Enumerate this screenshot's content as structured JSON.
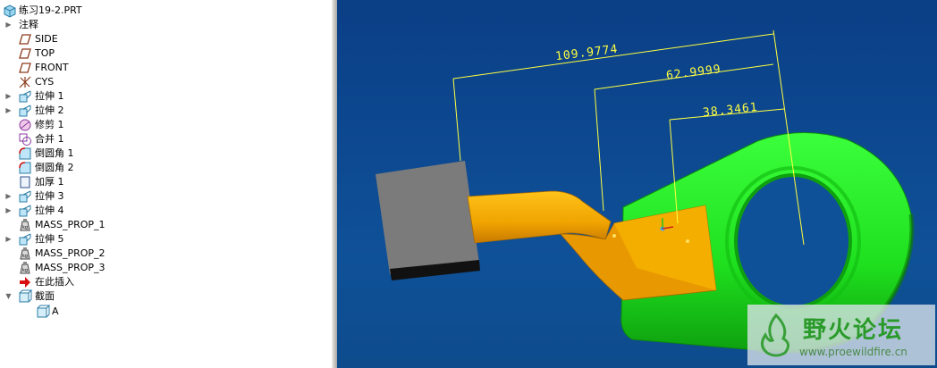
{
  "model_tree": {
    "root": "练习19-2.PRT",
    "items": [
      {
        "label": "注释",
        "icon": "annotation-folder-icon",
        "expandable": true
      },
      {
        "label": "SIDE",
        "icon": "datum-plane-icon",
        "expandable": false
      },
      {
        "label": "TOP",
        "icon": "datum-plane-icon",
        "expandable": false
      },
      {
        "label": "FRONT",
        "icon": "datum-plane-icon",
        "expandable": false
      },
      {
        "label": "CYS",
        "icon": "coordinate-system-icon",
        "expandable": false
      },
      {
        "label": "拉伸 1",
        "icon": "extrude-icon",
        "expandable": true
      },
      {
        "label": "拉伸 2",
        "icon": "extrude-icon",
        "expandable": true
      },
      {
        "label": "修剪 1",
        "icon": "trim-icon",
        "expandable": false
      },
      {
        "label": "合并 1",
        "icon": "merge-icon",
        "expandable": false
      },
      {
        "label": "倒圆角 1",
        "icon": "round-icon",
        "expandable": false
      },
      {
        "label": "倒圆角 2",
        "icon": "round-icon",
        "expandable": false
      },
      {
        "label": "加厚 1",
        "icon": "thicken-icon",
        "expandable": false
      },
      {
        "label": "拉伸 3",
        "icon": "extrude-icon",
        "expandable": true
      },
      {
        "label": "拉伸 4",
        "icon": "extrude-icon",
        "expandable": true
      },
      {
        "label": "MASS_PROP_1",
        "icon": "analysis-icon",
        "expandable": false
      },
      {
        "label": "拉伸 5",
        "icon": "extrude-icon",
        "expandable": true
      },
      {
        "label": "MASS_PROP_2",
        "icon": "analysis-icon",
        "expandable": false
      },
      {
        "label": "MASS_PROP_3",
        "icon": "analysis-icon",
        "expandable": false
      },
      {
        "label": "在此插入",
        "icon": "insert-here-arrow-icon",
        "expandable": false
      },
      {
        "label": "截面",
        "icon": "section-icon",
        "expandable": true,
        "expanded": true
      },
      {
        "label": "A",
        "icon": "section-icon",
        "expandable": false
      }
    ]
  },
  "viewport": {
    "dimensions": [
      "109.9774",
      "62.9999",
      "38.3461"
    ],
    "colors": {
      "background": "#0d4a92",
      "dimension": "#ffff40",
      "solid_green": "#22e622",
      "surface_orange": "#f0a400",
      "block_gray": "#7b7b7b"
    }
  },
  "watermark": {
    "title": "野火论坛",
    "url": "www.proewildfire.cn"
  }
}
